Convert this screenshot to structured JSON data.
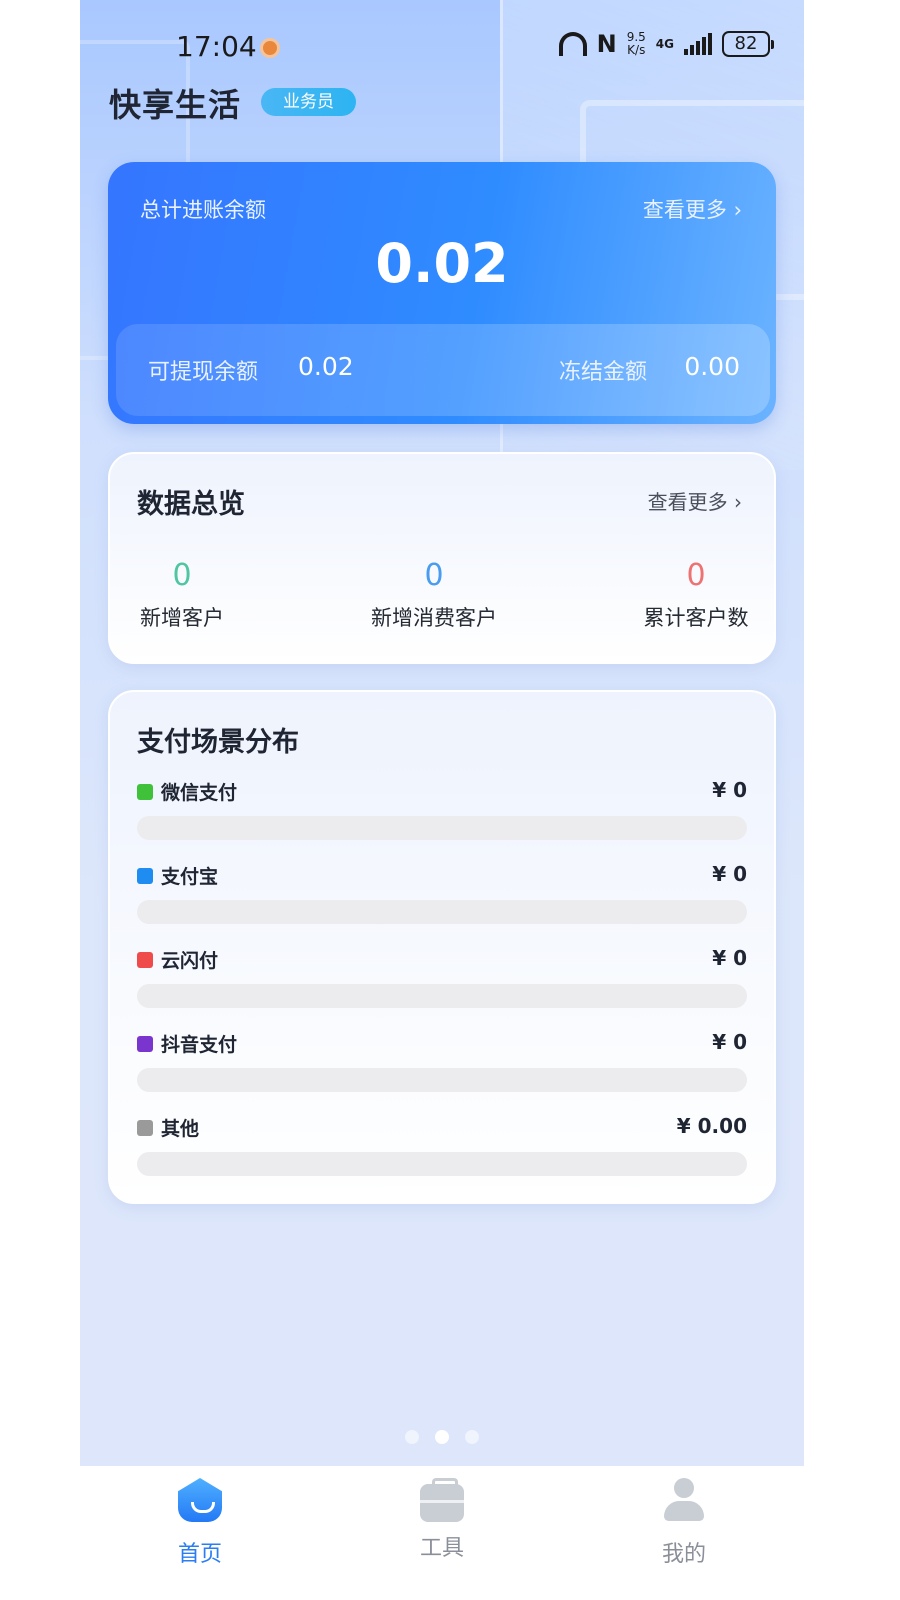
{
  "status_bar": {
    "time": "17:04",
    "net_speed_value": "9.5",
    "net_speed_unit": "K/s",
    "network_type": "4G",
    "battery": "82",
    "nfc_label": "N"
  },
  "header": {
    "title": "快享生活",
    "role_badge": "业务员"
  },
  "balance_card": {
    "label": "总计进账余额",
    "more_label": "查看更多 ›",
    "amount": "0.02",
    "withdrawable_label": "可提现余额",
    "withdrawable_value": "0.02",
    "frozen_label": "冻结金额",
    "frozen_value": "0.00"
  },
  "overview": {
    "title": "数据总览",
    "more_label": "查看更多 ›",
    "stats": [
      {
        "value": "0",
        "label": "新增客户",
        "color": "#4fc6a0"
      },
      {
        "value": "0",
        "label": "新增消费客户",
        "color": "#4a9cf0"
      },
      {
        "value": "0",
        "label": "累计客户数",
        "color": "#ef7272"
      }
    ]
  },
  "payment": {
    "title": "支付场景分布",
    "items": [
      {
        "name": "微信支付",
        "amount": "¥ 0",
        "color": "#3fc23a",
        "share": 0
      },
      {
        "name": "支付宝",
        "amount": "¥ 0",
        "color": "#1e8cf0",
        "share": 0
      },
      {
        "name": "云闪付",
        "amount": "¥ 0",
        "color": "#f04b4b",
        "share": 0
      },
      {
        "name": "抖音支付",
        "amount": "¥ 0",
        "color": "#7b35cf",
        "share": 0
      },
      {
        "name": "其他",
        "amount": "¥ 0.00",
        "color": "#9a9a9a",
        "share": 0
      }
    ]
  },
  "pager": {
    "count": 3,
    "active_index": 1
  },
  "bottom_nav": {
    "items": [
      {
        "label": "首页",
        "icon": "home-icon",
        "active": true
      },
      {
        "label": "工具",
        "icon": "toolbox-icon",
        "active": false
      },
      {
        "label": "我的",
        "icon": "user-icon",
        "active": false
      }
    ],
    "accent_color": "#2a7df5"
  }
}
